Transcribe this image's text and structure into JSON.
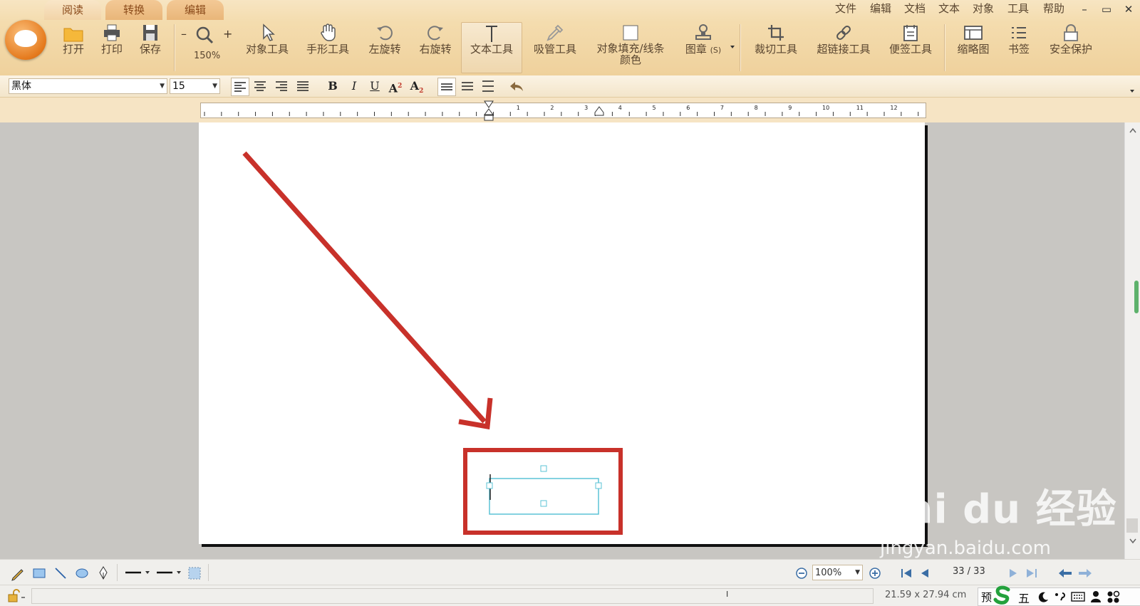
{
  "tabs": [
    "阅读",
    "转换",
    "编辑"
  ],
  "menu": [
    "文件",
    "编辑",
    "文档",
    "文本",
    "对象",
    "工具",
    "帮助"
  ],
  "window_controls": [
    "–",
    "▭",
    "✕"
  ],
  "toolbar": {
    "open": "打开",
    "print": "打印",
    "save": "保存",
    "zoom_minus": "–",
    "zoom_plus": "+",
    "zoom_value": "150%",
    "object_tool": "对象工具",
    "hand_tool": "手形工具",
    "rotate_left": "左旋转",
    "rotate_right": "右旋转",
    "text_tool": "文本工具",
    "eyedropper": "吸管工具",
    "fill_line1": "对象填充/线条",
    "fill_line2": "颜色",
    "stamp": "图章",
    "stamp_hotkey": "(S)",
    "crop": "裁切工具",
    "hyperlink": "超链接工具",
    "note": "便签工具",
    "thumbnail": "缩略图",
    "bookmark": "书签",
    "security": "安全保护"
  },
  "format": {
    "font": "黑体",
    "size": "15",
    "bold": "B",
    "italic": "I",
    "underline": "U",
    "superscript": "A",
    "sup_mark": "2",
    "subscript": "A",
    "sub_mark": "2"
  },
  "ruler": {
    "labels": [
      "1",
      "2",
      "3",
      "4",
      "5",
      "6",
      "7",
      "8",
      "9",
      "10",
      "11",
      "12"
    ]
  },
  "status": {
    "zoom": "100%",
    "page": "33 / 33",
    "page_size": "21.59 x 27.94 cm",
    "ime_label": "预",
    "ime_mode": "五",
    "i_beam": "I"
  },
  "watermark": {
    "brand": "Bai du 经验",
    "url": "jingyan.baidu.com"
  },
  "colors": {
    "annotation_red": "#c8312a",
    "textbox_cyan": "#5bc3d6",
    "ribbon": "#f4dcae"
  }
}
